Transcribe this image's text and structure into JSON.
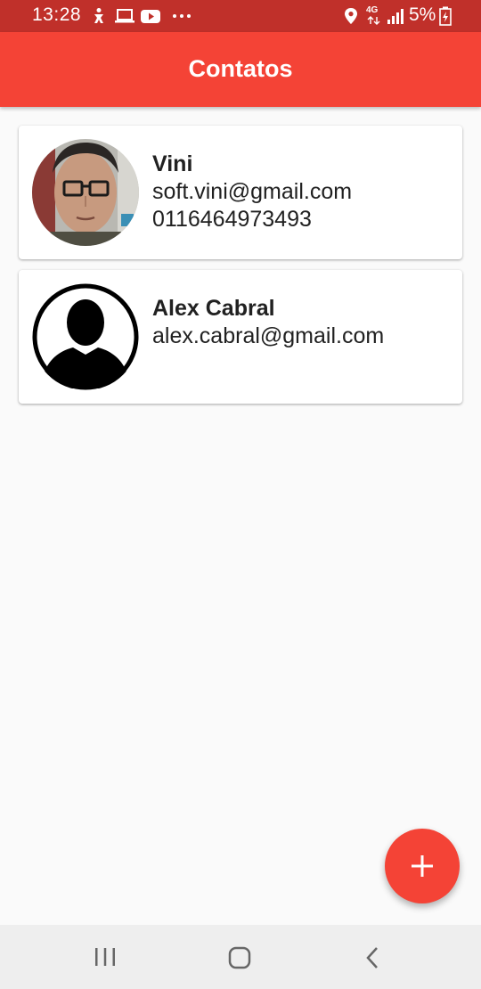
{
  "status_bar": {
    "time": "13:28",
    "network": "4G",
    "battery": "5%"
  },
  "app_bar": {
    "title": "Contatos"
  },
  "contacts": [
    {
      "name": "Vini",
      "email": "soft.vini@gmail.com",
      "phone": "0116464973493",
      "avatar": "photo"
    },
    {
      "name": "Alex Cabral",
      "email": "alex.cabral@gmail.com",
      "avatar": "person-silhouette-icon"
    }
  ],
  "fab": {
    "icon": "plus-icon"
  },
  "nav_bar": {
    "icons": [
      "recent-apps-icon",
      "home-icon",
      "back-icon"
    ]
  },
  "colors": {
    "primary": "#f44336",
    "status_bar": "#c0302a",
    "background": "#fafafa",
    "text": "#212121"
  }
}
